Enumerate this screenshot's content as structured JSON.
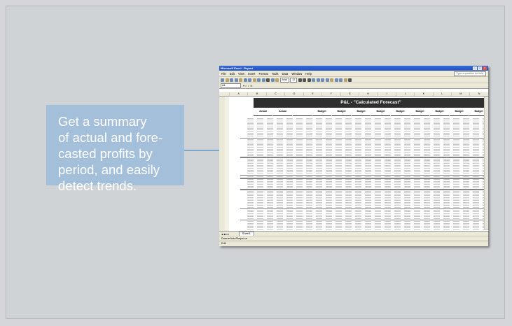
{
  "callout": {
    "lines": [
      "Get a summary",
      "of actual and fore-",
      "casted profits by",
      "period, and easily",
      "detect trends."
    ]
  },
  "screenshot": {
    "window_title": "Microsoft Excel - Report",
    "menu": [
      "File",
      "Edit",
      "View",
      "Insert",
      "Format",
      "Tools",
      "Data",
      "Window",
      "Help"
    ],
    "help_placeholder": "Type a question for help",
    "font_name": "Arial",
    "font_size": "12",
    "name_box": "A1",
    "columns": [
      "A",
      "B",
      "C",
      "D",
      "E",
      "F",
      "G",
      "H",
      "I",
      "J",
      "K",
      "L",
      "M",
      "N"
    ],
    "banner": "P&L - \"Calculated Forecast\"",
    "header_row": [
      "Actual",
      "Actual",
      "",
      "Budget",
      "Budget",
      "Budget",
      "Budget",
      "Budget",
      "Budget",
      "Budget",
      "Budget",
      "Budget"
    ],
    "sheet_tab": "Sheet1",
    "draw_label": "Draw ▾   AutoShapes ▾",
    "status": "Edit"
  },
  "colors": {
    "callout_bg": "#a3bfd9",
    "connector": "#7fa6cb",
    "panel_bg": "#d0d3d6",
    "banner_bg": "#2f2f2f"
  }
}
